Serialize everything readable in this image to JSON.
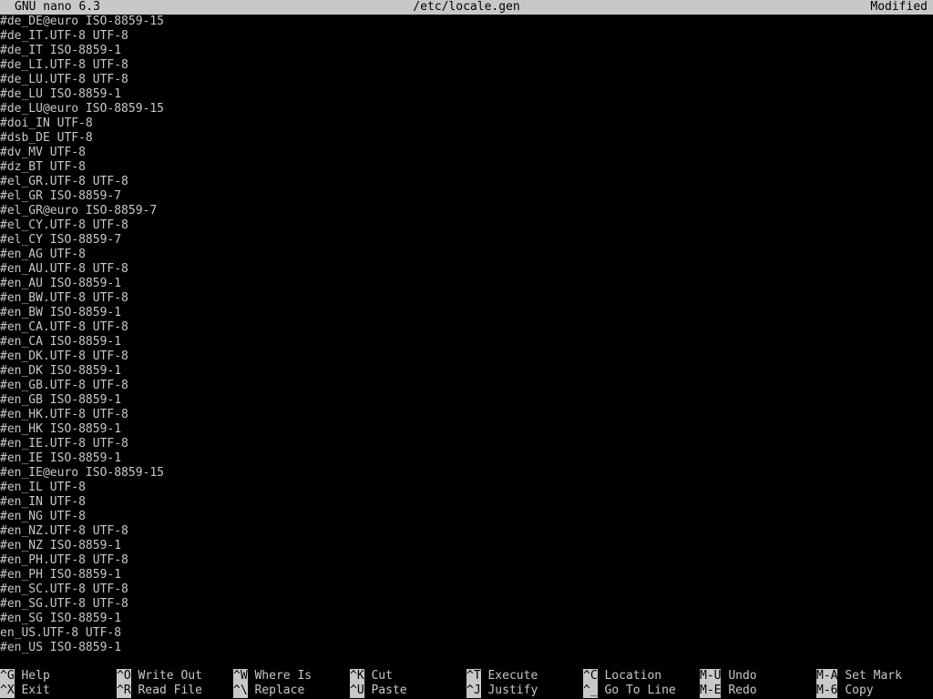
{
  "title_bar": {
    "app": "GNU nano 6.3",
    "file": "/etc/locale.gen",
    "status": "Modified"
  },
  "lines": [
    "#de_DE@euro ISO-8859-15",
    "#de_IT.UTF-8 UTF-8",
    "#de_IT ISO-8859-1",
    "#de_LI.UTF-8 UTF-8",
    "#de_LU.UTF-8 UTF-8",
    "#de_LU ISO-8859-1",
    "#de_LU@euro ISO-8859-15",
    "#doi_IN UTF-8",
    "#dsb_DE UTF-8",
    "#dv_MV UTF-8",
    "#dz_BT UTF-8",
    "#el_GR.UTF-8 UTF-8",
    "#el_GR ISO-8859-7",
    "#el_GR@euro ISO-8859-7",
    "#el_CY.UTF-8 UTF-8",
    "#el_CY ISO-8859-7",
    "#en_AG UTF-8",
    "#en_AU.UTF-8 UTF-8",
    "#en_AU ISO-8859-1",
    "#en_BW.UTF-8 UTF-8",
    "#en_BW ISO-8859-1",
    "#en_CA.UTF-8 UTF-8",
    "#en_CA ISO-8859-1",
    "#en_DK.UTF-8 UTF-8",
    "#en_DK ISO-8859-1",
    "#en_GB.UTF-8 UTF-8",
    "#en_GB ISO-8859-1",
    "#en_HK.UTF-8 UTF-8",
    "#en_HK ISO-8859-1",
    "#en_IE.UTF-8 UTF-8",
    "#en_IE ISO-8859-1",
    "#en_IE@euro ISO-8859-15",
    "#en_IL UTF-8",
    "#en_IN UTF-8",
    "#en_NG UTF-8",
    "#en_NZ.UTF-8 UTF-8",
    "#en_NZ ISO-8859-1",
    "#en_PH.UTF-8 UTF-8",
    "#en_PH ISO-8859-1",
    "#en_SC.UTF-8 UTF-8",
    "#en_SG.UTF-8 UTF-8",
    "#en_SG ISO-8859-1",
    "en_US.UTF-8 UTF-8",
    "#en_US ISO-8859-1"
  ],
  "shortcuts": {
    "row1": [
      {
        "key": "^G",
        "label": "Help"
      },
      {
        "key": "^O",
        "label": "Write Out"
      },
      {
        "key": "^W",
        "label": "Where Is"
      },
      {
        "key": "^K",
        "label": "Cut"
      },
      {
        "key": "^T",
        "label": "Execute"
      },
      {
        "key": "^C",
        "label": "Location"
      },
      {
        "key": "M-U",
        "label": "Undo"
      },
      {
        "key": "M-A",
        "label": "Set Mark"
      }
    ],
    "row2": [
      {
        "key": "^X",
        "label": "Exit"
      },
      {
        "key": "^R",
        "label": "Read File"
      },
      {
        "key": "^\\",
        "label": "Replace"
      },
      {
        "key": "^U",
        "label": "Paste"
      },
      {
        "key": "^J",
        "label": "Justify"
      },
      {
        "key": "^_",
        "label": "Go To Line"
      },
      {
        "key": "M-E",
        "label": "Redo"
      },
      {
        "key": "M-6",
        "label": "Copy"
      }
    ]
  }
}
